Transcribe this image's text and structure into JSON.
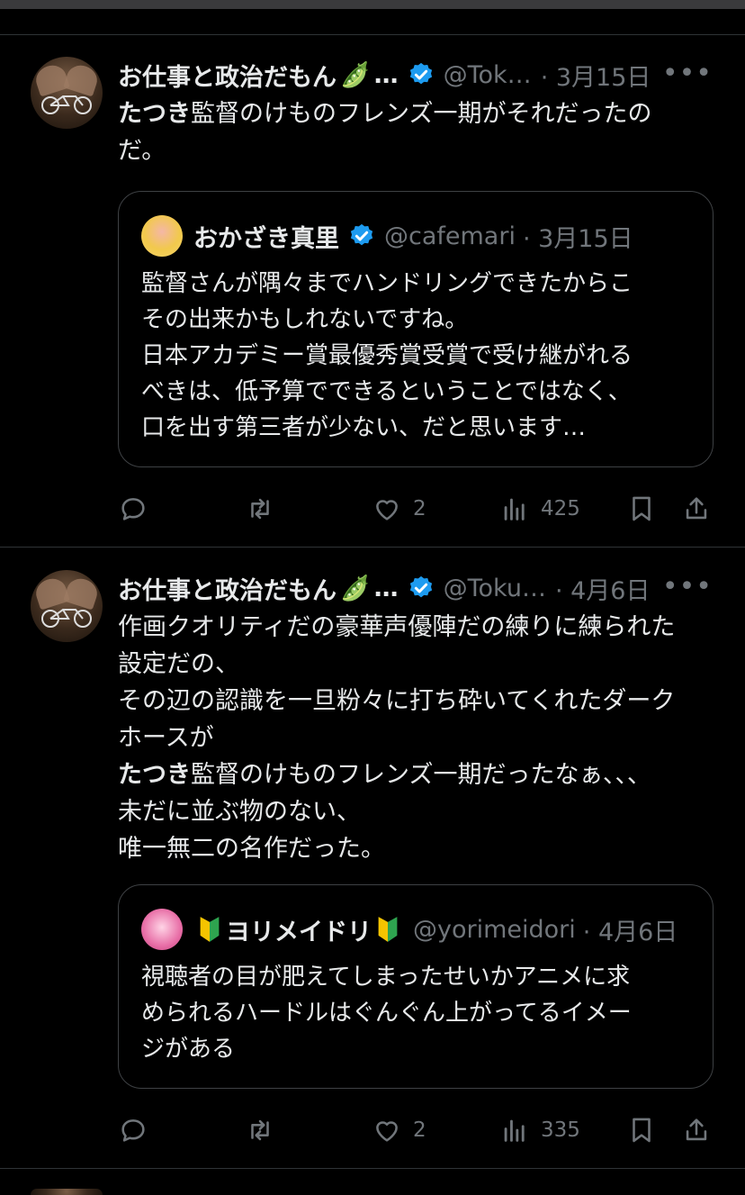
{
  "tweets": [
    {
      "author": {
        "name": "お仕事と政治だもん",
        "emoji": "🫛",
        "ellipsis": "…",
        "handle": "@Tok…",
        "date": "· 3月15日",
        "more": "•••"
      },
      "text_lines": [
        {
          "bold": "たつき",
          "rest": "監督のけものフレンズ一期がそれだったの"
        },
        {
          "bold": "",
          "rest": "だ。"
        }
      ],
      "quote": {
        "name": "おかざき真里",
        "prefix_icon": "",
        "suffix_icon": "",
        "handle": "@cafemari",
        "date": "· 3月15日",
        "lines": [
          "監督さんが隅々までハンドリングできたからこ",
          "その出来かもしれないですね。",
          "日本アカデミー賞最優秀賞受賞で受け継がれる",
          "べきは、低予算でできるということではなく、",
          "口を出す第三者が少ない、だと思います…"
        ]
      },
      "metrics": {
        "replies": "",
        "retweets": "",
        "likes": "2",
        "views": "425"
      }
    },
    {
      "author": {
        "name": "お仕事と政治だもん",
        "emoji": "🫛",
        "ellipsis": "…",
        "handle": "@Toku…",
        "date": "· 4月6日",
        "more": "•••"
      },
      "text_lines": [
        {
          "bold": "",
          "rest": "作画クオリティだの豪華声優陣だの練りに練られた"
        },
        {
          "bold": "",
          "rest": "設定だの、"
        },
        {
          "bold": "",
          "rest": "その辺の認識を一旦粉々に打ち砕いてくれたダーク"
        },
        {
          "bold": "",
          "rest": "ホースが"
        },
        {
          "bold": "たつき",
          "rest": "監督のけものフレンズ一期だったなぁ、、、"
        },
        {
          "bold": "",
          "rest": "未だに並ぶ物のない、"
        },
        {
          "bold": "",
          "rest": "唯一無二の名作だった。"
        }
      ],
      "quote": {
        "name": "ヨリメイドリ",
        "prefix_icon": "wakaba-mark-icon",
        "suffix_icon": "wakaba-mark-icon",
        "handle": "@yorimeidori",
        "date": "· 4月6日",
        "lines": [
          "視聴者の目が肥えてしまったせいかアニメに求",
          "められるハードルはぐんぐん上がってるイメー",
          "ジがある"
        ]
      },
      "metrics": {
        "replies": "",
        "retweets": "",
        "likes": "2",
        "views": "335"
      }
    }
  ],
  "icons": {
    "verified": "verified-badge-icon",
    "reply": "reply-icon",
    "retweet": "retweet-icon",
    "like": "heart-icon",
    "views": "views-bar-icon",
    "bookmark": "bookmark-icon",
    "share": "share-icon"
  },
  "colors": {
    "background": "#000000",
    "text": "#e7e9ea",
    "muted": "#71767b",
    "verified": "#1d9bf0",
    "border": "#2f3336"
  }
}
